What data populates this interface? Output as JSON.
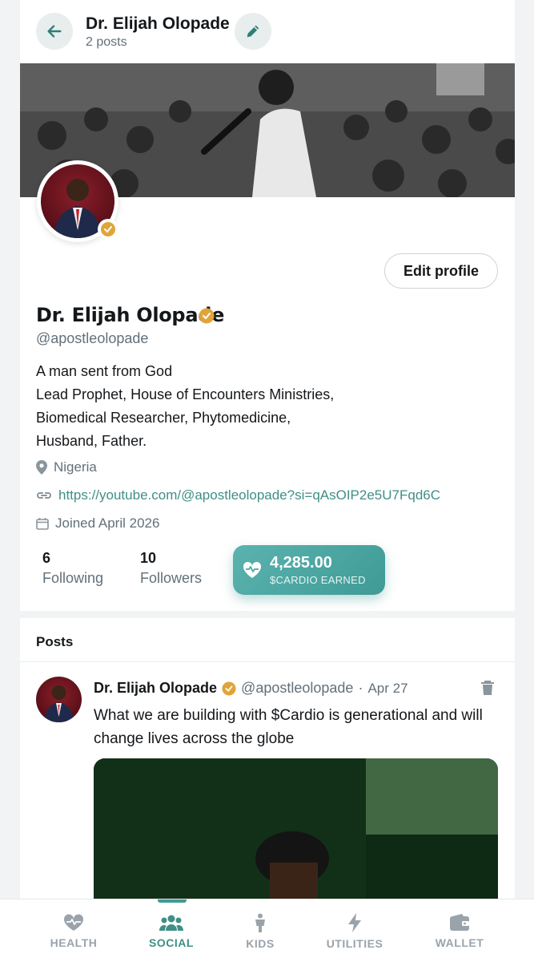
{
  "header": {
    "back_icon": "arrow-left-icon",
    "name": "Dr. Elijah Olopade",
    "post_count": "2 posts",
    "edit_icon": "pencil-icon"
  },
  "profile": {
    "name": "Dr. Elijah Olopade",
    "handle": "@apostleolopade",
    "verified_color": "#e0a43a",
    "edit_button": "Edit profile",
    "bio": [
      "A man sent from God",
      "Lead Prophet, House of Encounters Ministries,",
      "Biomedical Researcher, Phytomedicine,",
      "Husband, Father."
    ],
    "location": "Nigeria",
    "link": "https://youtube.com/@apostleolopade?si=qAsOIP2e5U7Fqd6C",
    "joined": "Joined April 2026",
    "following_count": "6",
    "following_label": "Following",
    "followers_count": "10",
    "followers_label": "Followers",
    "earned_amount": "4,285.00",
    "earned_label": "$CARDIO EARNED"
  },
  "posts": {
    "title": "Posts",
    "items": [
      {
        "author": "Dr. Elijah Olopade",
        "handle": "@apostleolopade",
        "separator": "·",
        "date": "Apr 27",
        "text": "What we are building with $Cardio is generational and will change lives across the globe"
      }
    ]
  },
  "bottom_nav": {
    "active": "SOCIAL",
    "accent_color": "#3f8f86",
    "items": [
      {
        "label": "HEALTH",
        "icon": "heart-pulse-icon"
      },
      {
        "label": "SOCIAL",
        "icon": "people-icon"
      },
      {
        "label": "KIDS",
        "icon": "child-icon"
      },
      {
        "label": "UTILITIES",
        "icon": "bolt-icon"
      },
      {
        "label": "WALLET",
        "icon": "wallet-icon"
      }
    ]
  }
}
